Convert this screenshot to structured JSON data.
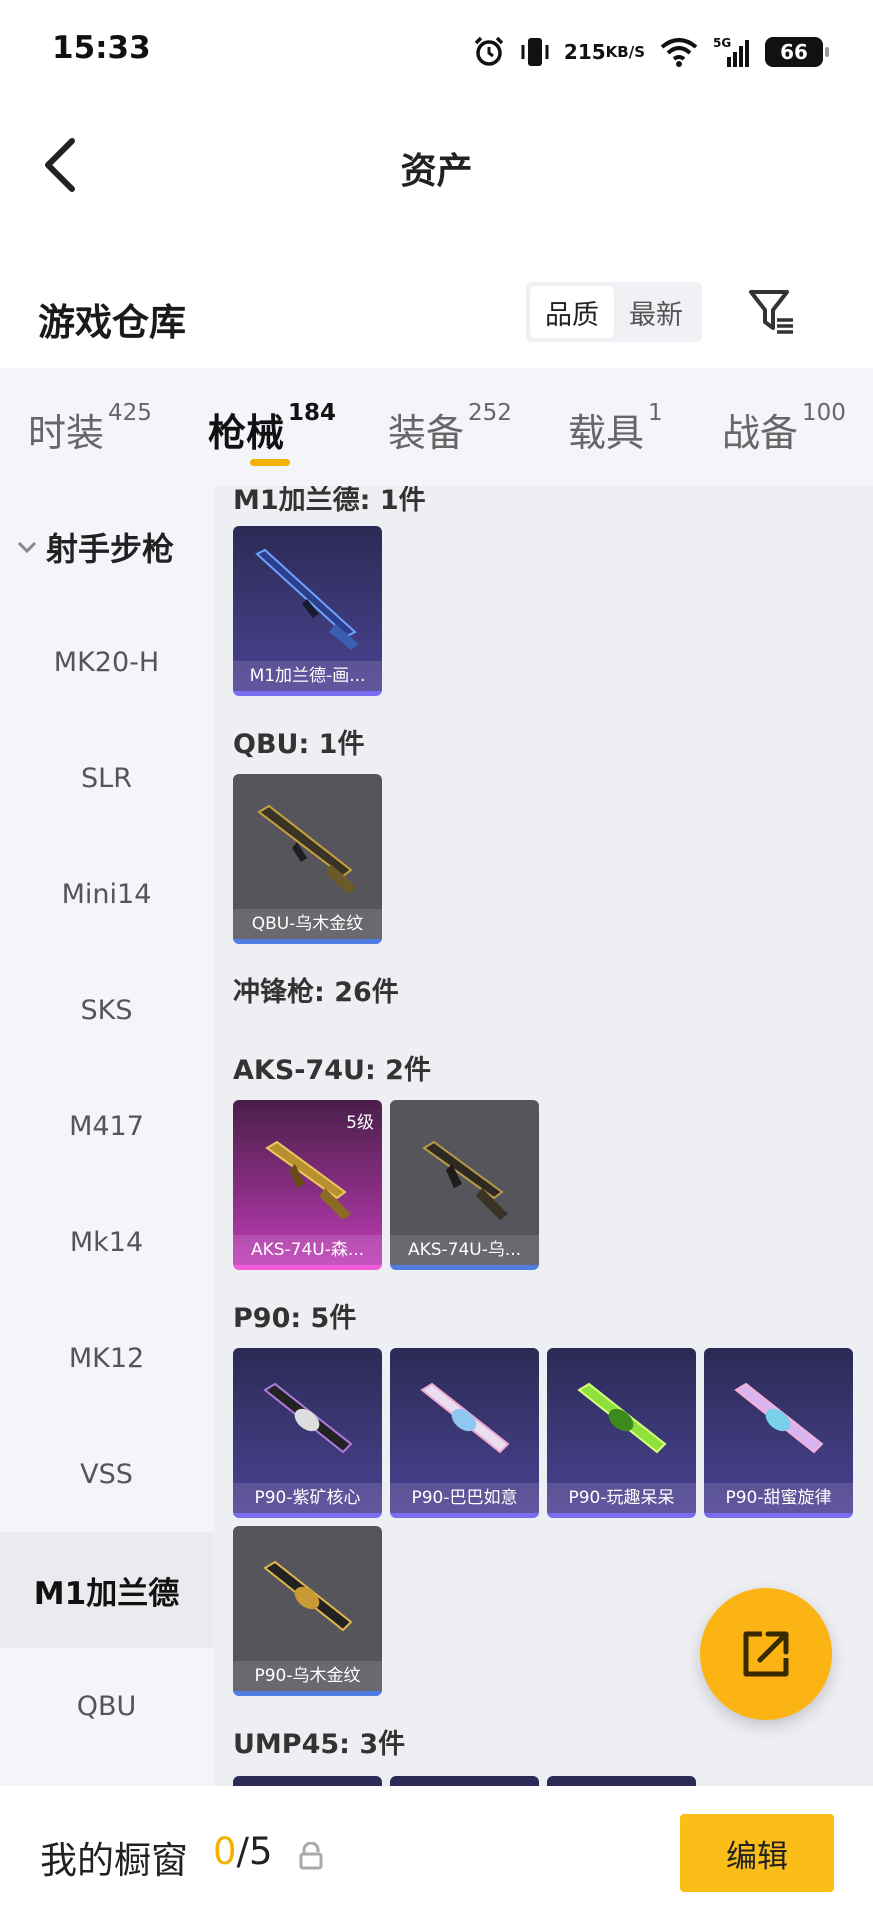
{
  "status_bar": {
    "time": "15:33",
    "net_speed_value": "215",
    "net_speed_unit": "KB/S",
    "network": "5G",
    "battery": "66",
    "icons": [
      "alarm-icon",
      "vibrate-icon",
      "wifi-icon",
      "signal-icon"
    ]
  },
  "header": {
    "title": "资产"
  },
  "warehouse": {
    "title": "游戏仓库",
    "sort_options": [
      "品质",
      "最新"
    ],
    "sort_selected": "品质"
  },
  "tabs": [
    {
      "label": "时装",
      "count": "425"
    },
    {
      "label": "枪械",
      "count": "184",
      "active": true
    },
    {
      "label": "装备",
      "count": "252"
    },
    {
      "label": "载具",
      "count": "1"
    },
    {
      "label": "战备",
      "count": "100"
    }
  ],
  "sidebar": {
    "group": "射手步枪",
    "items": [
      "MK20-H",
      "SLR",
      "Mini14",
      "SKS",
      "M417",
      "Mk14",
      "MK12",
      "VSS",
      "M1加兰德",
      "QBU"
    ],
    "active": "M1加兰德"
  },
  "content": {
    "partial_top": "M1加兰德: 1件",
    "groups": {
      "m1": {
        "cards": [
          {
            "name": "M1加兰德-画...",
            "rarity": "purple"
          }
        ]
      },
      "qbu": {
        "label": "QBU: 1件",
        "cards": [
          {
            "name": "QBU-乌木金纹",
            "rarity": "gray"
          }
        ]
      },
      "smg": {
        "label": "冲锋枪: 26件"
      },
      "aks": {
        "label": "AKS-74U: 2件",
        "cards": [
          {
            "name": "AKS-74U-森...",
            "rarity": "pink",
            "level": "5级"
          },
          {
            "name": "AKS-74U-乌...",
            "rarity": "gray"
          }
        ]
      },
      "p90": {
        "label": "P90: 5件",
        "cards": [
          {
            "name": "P90-紫矿核心",
            "rarity": "purple"
          },
          {
            "name": "P90-巴巴如意",
            "rarity": "purple"
          },
          {
            "name": "P90-玩趣呆呆",
            "rarity": "purple"
          },
          {
            "name": "P90-甜蜜旋律",
            "rarity": "purple"
          },
          {
            "name": "P90-乌木金纹",
            "rarity": "gray"
          }
        ]
      },
      "ump": {
        "label": "UMP45: 3件"
      }
    }
  },
  "bottom_bar": {
    "title": "我的橱窗",
    "current": "0",
    "separator": "/",
    "total": "5",
    "edit_label": "编辑"
  },
  "colors": {
    "accent": "#f5b100",
    "purple_rarity": "#7a6ef0",
    "pink_rarity": "#f25bd9",
    "blue_rarity": "#4f7de3"
  }
}
